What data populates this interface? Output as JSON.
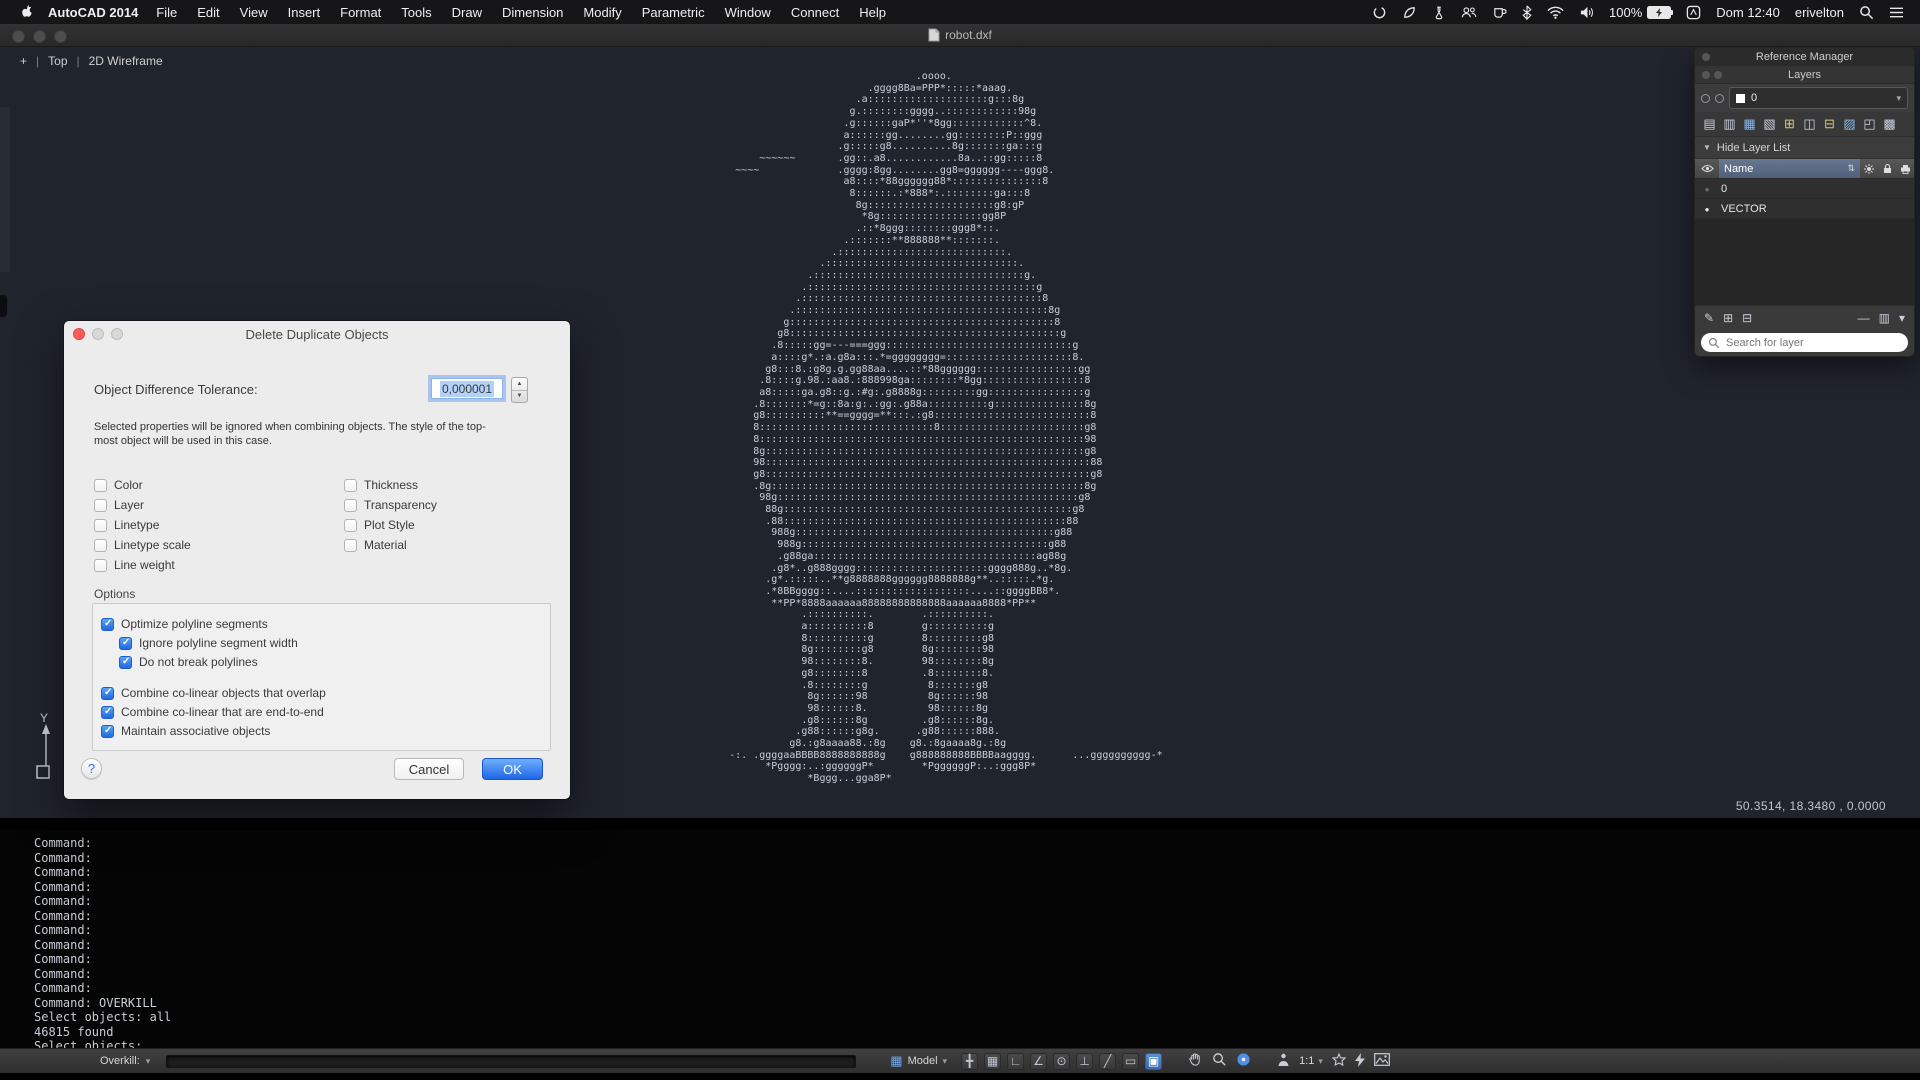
{
  "menu_bar": {
    "app_name": "AutoCAD 2014",
    "menus": [
      "File",
      "Edit",
      "View",
      "Insert",
      "Format",
      "Tools",
      "Draw",
      "Dimension",
      "Modify",
      "Parametric",
      "Window",
      "Connect",
      "Help"
    ],
    "battery_label": "100%",
    "clock": "Dom 12:40",
    "user": "erivelton"
  },
  "titlebar": {
    "title": "robot.dxf"
  },
  "viewport_controls": {
    "expand": "+",
    "view": "Top",
    "style": "2D Wireframe"
  },
  "canvas": {
    "coordinates": "50.3514, 18.3480 , 0.0000",
    "ucs_axis_label": "Y"
  },
  "ascii_art": {
    "lines": [
      "                                      .oooo.",
      "                              .gggg8Ba=PPP*:::::*aaag.",
      "                            .a::::::::::::::::::::g:::8g",
      "                           g.::::::::gggg..::::::::::::98g",
      "                          .g::::::gaP*''*8gg::::::::::::^8.",
      "                          a::::::gg........gg::::::::P::ggg",
      "                         .g:::::g8..........8g:::::::ga:::g",
      "            ~~~~~~       .gg::.a8............8a..::gg:::::8",
      "        ~~~~             .gggg:8gg........gg8=gggggg----ggg8.",
      "                          a8::::*88gggggg88*:::::::::::::::8",
      "                           8::::::.:*888*:.::::::::ga:::8",
      "                            8g:::::::::::::::::::::g8:gP",
      "                             *8g:::::::::::::::::gg8P",
      "                            .::*8ggg::::::::ggg8*::.",
      "                          .:::::::**888888**:::::::.",
      "                        .::::::::::::::::::::::::::::.",
      "                      .::::::::::::::::::::::::::::::::.",
      "                    .:::::::::::::::::::::::::::::::::::g.",
      "                   .::::::::::::::::::::::::::::::::::::::g",
      "                  .::::::::::::::::::::::::::::::::::::::::8",
      "                 .::::::::::::::::::::::::::::::::::::::::::8g",
      "                g::::::::::::::::::::::::::::::::::::::::::::8",
      "               g8:::::::::::::::::::::::::::::::::::::::::::::g",
      "              .8:::::gg=---===ggg:::::::::::::::::::::::::::::::g",
      "              a::::g*.:a.g8a:::.*=gggggggg=:::::::::::::::::::::8.",
      "             g8:::8.:g8g.g.gg88aa....::*88gggggg:::::::::::::::::gg",
      "            .8::::g.98.:aa8.:888998ga::::::::*8gg:::::::::::::::::8",
      "            a8:::::ga.g8::g.:#g:.g8888g:::::::::gg::::::::::::::::g",
      "           .8:::::::*=g::8a:g:.:gg:.g88a::::::::::g:::::::::::::::8g",
      "           g8::::::::::**==gggg=**:::.:g8::::::::::::::::::::::::::8",
      "           8:::::::::::::::::::::::::::::8::::::::::::::::::::::::g8",
      "           8::::::::::::::::::::::::::::::::::::::::::::::::::::::98",
      "           8g:::::::::::::::::::::::::::::::::::::::::::::::::::::g8",
      "           98::::::::::::::::::::::::::::::::::::::::::::::::::::::88",
      "           g8::::::::::::::::::::::::::::::::::::::::::::::::::::::g8",
      "           .8g::::::::::::::::::::::::::::::::::::::::::::::::::::8g",
      "            98g::::::::::::::::::::::::::::::::::::::::::::::::::g8",
      "             88g::::::::::::::::::::::::::::::::::::::::::::::::g8",
      "             .88:::::::::::::::::::::::::::::::::::::::::::::::88",
      "              988g:::::::::::::::::::::::::::::::::::::::::::g88",
      "               988g:::::::::::::::::::::::::::::::::::::::::g88",
      "               .g88ga:::::::::::::::::::::::::::::::::::::ag88g",
      "              .g8*..g888gggg::::::::::::::::::::::gggg888g..*8g.",
      "             .g*.:::::..**g8888888gggggg8888888g**..:::::.*g.",
      "             .*8BBgggg::....:::::::::::::::::::....::ggggBB8*.",
      "              **PP*8888aaaaaa88888888888888aaaaaa8888*PP**",
      "                   .::::::::::.        .::::::::::.",
      "                   a::::::::::8        g::::::::::g",
      "                   8::::::::::g        8:::::::::g8",
      "                   8g::::::::g8        8g::::::::98",
      "                   98::::::::8.        98::::::::8g",
      "                   g8::::::::8         .8::::::::8.",
      "                   .8::::::::g          8:::::::g8",
      "                    8g::::::98          8g::::::98",
      "                    98::::::8.          98::::::8g",
      "                   .g8::::::8g         .g8::::::8g.",
      "                  .g88::::::g8g.      .g88::::::888.",
      "                 g8.:g8aaaa88.:8g    g8.:8gaaaa8g.:8g",
      "       -:. .ggggaaBBBB8888888888g    g888888888BBBBaagggg.      ...gggggggggg-*",
      "             *Pgggg:..:ggggggP*        *PggggggP:..:ggg8P*",
      "                    *Bggg...gga8P*"
    ]
  },
  "dialog": {
    "title": "Delete Duplicate Objects",
    "tolerance_label": "Object Difference Tolerance:",
    "tolerance_value": "0,000001",
    "description_line1": "Selected properties will be ignored when combining objects. The style of the top-",
    "description_line2": "most object will be used in this case.",
    "properties_left": [
      "Color",
      "Layer",
      "Linetype",
      "Linetype scale",
      "Line weight"
    ],
    "properties_right": [
      "Thickness",
      "Transparency",
      "Plot Style",
      "Material"
    ],
    "options_title": "Options",
    "options": [
      {
        "label": "Optimize polyline segments",
        "checked": true,
        "indent": 0
      },
      {
        "label": "Ignore polyline segment width",
        "checked": true,
        "indent": 1
      },
      {
        "label": "Do not break polylines",
        "checked": true,
        "indent": 1
      },
      {
        "label": "Combine co-linear objects that overlap",
        "checked": true,
        "indent": 0,
        "gap": true
      },
      {
        "label": "Combine co-linear that are end-to-end",
        "checked": true,
        "indent": 0
      },
      {
        "label": "Maintain associative objects",
        "checked": true,
        "indent": 0
      }
    ],
    "help_label": "?",
    "cancel_label": "Cancel",
    "ok_label": "OK"
  },
  "layers_panel": {
    "window_title": "Reference Manager",
    "palette_title": "Layers",
    "current_layer": "0",
    "hide_list_label": "Hide Layer List",
    "name_column": "Name",
    "rows": [
      {
        "name": "0",
        "eye_on": false
      },
      {
        "name": "VECTOR",
        "eye_on": true
      }
    ],
    "search_placeholder": "Search for layer",
    "layer_tools": [
      {
        "name": "layer-filter-icon",
        "glyph": "▤",
        "color": "#c6cede"
      },
      {
        "name": "new-property-filter-icon",
        "glyph": "▥",
        "color": "#c6cede"
      },
      {
        "name": "new-group-filter-icon",
        "glyph": "▦",
        "color": "#86b7e8"
      },
      {
        "name": "layer-states-icon",
        "glyph": "▧",
        "color": "#c6cede"
      },
      {
        "name": "new-layer-icon",
        "glyph": "⊞",
        "color": "#d9c87b"
      },
      {
        "name": "new-vp-frozen-layer-icon",
        "glyph": "◫",
        "color": "#c6cede"
      },
      {
        "name": "delete-layer-icon",
        "glyph": "⊟",
        "color": "#d9c87b"
      },
      {
        "name": "set-current-icon",
        "glyph": "▨",
        "color": "#86b7e8"
      },
      {
        "name": "isolate-layer-icon",
        "glyph": "◰",
        "color": "#c6cede"
      },
      {
        "name": "layer-settings-icon",
        "glyph": "▩",
        "color": "#c6cede"
      }
    ],
    "bottom_tools_left": [
      {
        "name": "edit-layer-icon",
        "glyph": "✎"
      },
      {
        "name": "new-folder-icon",
        "glyph": "⊞"
      },
      {
        "name": "remove-folder-icon",
        "glyph": "⊟"
      }
    ],
    "bottom_tools_right": [
      {
        "name": "remove-item-icon",
        "glyph": "—"
      },
      {
        "name": "columns-icon",
        "glyph": "▥"
      },
      {
        "name": "panel-menu-icon",
        "glyph": "▾"
      }
    ]
  },
  "command_area": {
    "lines": [
      "Command:",
      "Command:",
      "Command:",
      "Command:",
      "Command:",
      "Command:",
      "Command:",
      "Command:",
      "Command:",
      "Command:",
      "Command:",
      "Command: OVERKILL",
      "Select objects: all",
      "46815 found",
      "Select objects:"
    ]
  },
  "status_bar": {
    "overkill_label": "Overkill:",
    "model_label": "Model",
    "scale_label": "1:1",
    "model_grid_glyph": "▦",
    "toggles": [
      {
        "name": "snap-mode-icon",
        "glyph": "╋"
      },
      {
        "name": "grid-display-icon",
        "glyph": "▦"
      },
      {
        "name": "ortho-mode-icon",
        "glyph": "∟"
      },
      {
        "name": "polar-tracking-icon",
        "glyph": "∠"
      },
      {
        "name": "object-snap-icon",
        "glyph": "⊙"
      },
      {
        "name": "object-snap-tracking-icon",
        "glyph": "⊥"
      },
      {
        "name": "dynamic-ucs-icon",
        "glyph": "╱"
      },
      {
        "name": "dynamic-input-icon",
        "glyph": "▭"
      },
      {
        "name": "lineweight-icon",
        "glyph": "▣",
        "active": true
      }
    ]
  },
  "icons": {
    "caret": "▾",
    "disclosure": "▼",
    "sort": "⇅"
  }
}
